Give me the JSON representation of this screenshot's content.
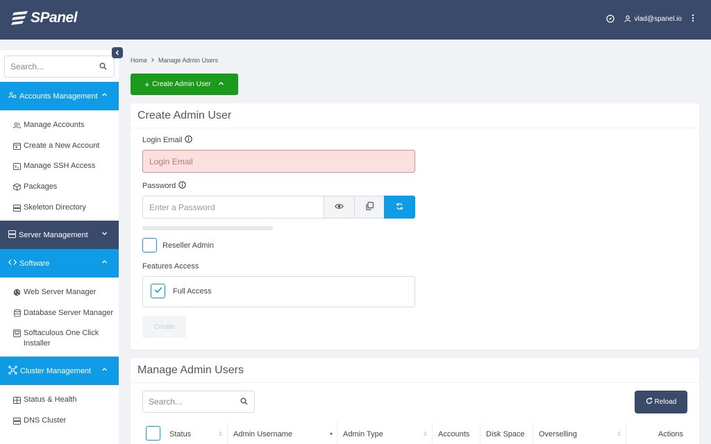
{
  "app": {
    "logo_text": "SPanel"
  },
  "topbar": {
    "user_email": "vlad@spanel.io"
  },
  "sidebar": {
    "search_placeholder": "Search...",
    "sections": [
      {
        "label": "Accounts Management",
        "items": [
          "Manage Accounts",
          "Create a New Account",
          "Manage SSH Access",
          "Packages",
          "Skeleton Directory"
        ]
      },
      {
        "label": "Server Management",
        "items": []
      },
      {
        "label": "Software",
        "items": [
          "Web Server Manager",
          "Database Server Manager",
          "Softaculous One Click Installer"
        ]
      },
      {
        "label": "Cluster Management",
        "items": [
          "Status & Health",
          "DNS Cluster"
        ]
      }
    ]
  },
  "breadcrumb": {
    "home": "Home",
    "current": "Manage Admin Users"
  },
  "create_button": {
    "label": "Create Admin User"
  },
  "create_form": {
    "title": "Create Admin User",
    "email_label": "Login Email",
    "email_placeholder": "Login Email",
    "password_label": "Password",
    "password_placeholder": "Enter a Password",
    "reseller_label": "Reseller Admin",
    "features_label": "Features Access",
    "full_access_label": "Full Access",
    "submit_label": "Create"
  },
  "manage_table": {
    "title": "Manage Admin Users",
    "search_placeholder": "Search...",
    "reload_label": "Reload",
    "columns": [
      "Status",
      "Admin Username",
      "Admin Type",
      "Accounts",
      "Disk Space",
      "Overselling",
      "Actions"
    ]
  },
  "colors": {
    "topbar": "#3a4a6b",
    "accent": "#0f9be5",
    "success": "#1c9a1c",
    "error_bg": "#fbe0e0"
  }
}
